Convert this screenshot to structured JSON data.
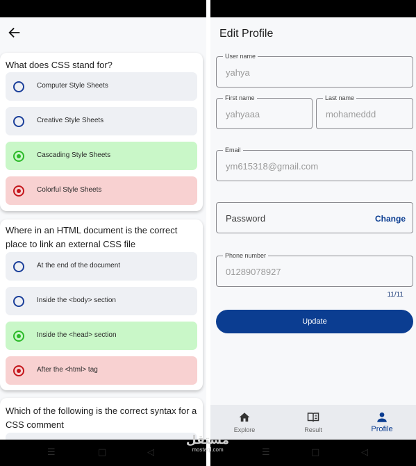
{
  "quiz": {
    "questions": [
      {
        "text": "What does CSS stand for?",
        "options": [
          {
            "label": "Computer Style Sheets",
            "state": "default"
          },
          {
            "label": "Creative Style Sheets",
            "state": "default"
          },
          {
            "label": "Cascading Style Sheets",
            "state": "correct"
          },
          {
            "label": "Colorful Style Sheets",
            "state": "wrong"
          }
        ]
      },
      {
        "text": "Where in an HTML document is the correct place to link an external CSS file",
        "options": [
          {
            "label": "At the end of the document",
            "state": "default"
          },
          {
            "label": "Inside the <body> section",
            "state": "default"
          },
          {
            "label": "Inside the <head> section",
            "state": "correct"
          },
          {
            "label": "After the <html> tag",
            "state": "wrong"
          }
        ]
      },
      {
        "text": "Which of the following is the correct syntax for a CSS comment",
        "options": []
      }
    ]
  },
  "profile": {
    "title": "Edit Profile",
    "username": {
      "label": "User name",
      "value": "yahya"
    },
    "first_name": {
      "label": "First name",
      "value": "yahyaaa"
    },
    "last_name": {
      "label": "Last name",
      "value": "mohameddd"
    },
    "email": {
      "label": "Email",
      "value": "ym615318@gmail.com"
    },
    "password": {
      "label": "Password",
      "action": "Change"
    },
    "phone": {
      "label": "Phone number",
      "value": "01289078927",
      "counter": "11/11"
    },
    "update_label": "Update"
  },
  "bottom_nav": {
    "items": [
      {
        "label": "Explore",
        "icon": "home-icon",
        "active": false
      },
      {
        "label": "Result",
        "icon": "book-icon",
        "active": false
      },
      {
        "label": "Profile",
        "icon": "person-icon",
        "active": true
      }
    ]
  },
  "watermark": {
    "arabic": "مستقل",
    "latin": "mostaql.com"
  },
  "colors": {
    "primary": "#0b3d91",
    "correct": "#2cba29",
    "correct_bg": "#c9f7c8",
    "wrong": "#c4161c",
    "wrong_bg": "#f8d1d1",
    "option_bg": "#eef0f4"
  }
}
